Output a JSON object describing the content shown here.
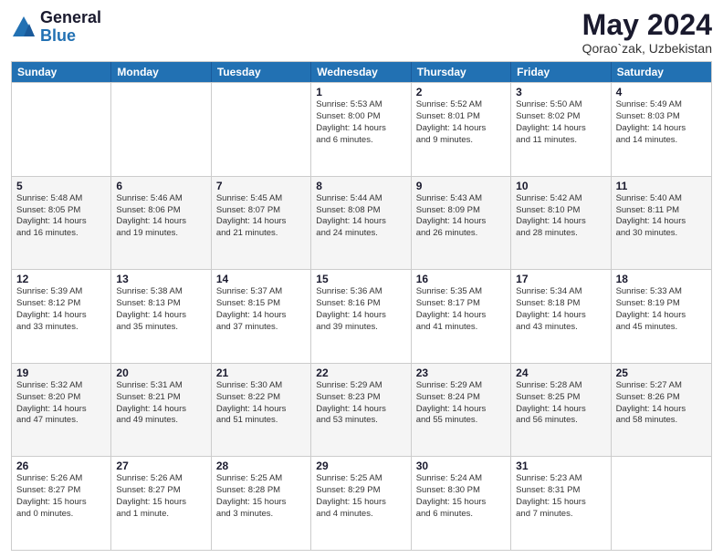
{
  "logo": {
    "general": "General",
    "blue": "Blue"
  },
  "title": "May 2024",
  "location": "Qorao`zak, Uzbekistan",
  "days_of_week": [
    "Sunday",
    "Monday",
    "Tuesday",
    "Wednesday",
    "Thursday",
    "Friday",
    "Saturday"
  ],
  "weeks": [
    [
      {
        "day": "",
        "info": ""
      },
      {
        "day": "",
        "info": ""
      },
      {
        "day": "",
        "info": ""
      },
      {
        "day": "1",
        "info": "Sunrise: 5:53 AM\nSunset: 8:00 PM\nDaylight: 14 hours\nand 6 minutes."
      },
      {
        "day": "2",
        "info": "Sunrise: 5:52 AM\nSunset: 8:01 PM\nDaylight: 14 hours\nand 9 minutes."
      },
      {
        "day": "3",
        "info": "Sunrise: 5:50 AM\nSunset: 8:02 PM\nDaylight: 14 hours\nand 11 minutes."
      },
      {
        "day": "4",
        "info": "Sunrise: 5:49 AM\nSunset: 8:03 PM\nDaylight: 14 hours\nand 14 minutes."
      }
    ],
    [
      {
        "day": "5",
        "info": "Sunrise: 5:48 AM\nSunset: 8:05 PM\nDaylight: 14 hours\nand 16 minutes."
      },
      {
        "day": "6",
        "info": "Sunrise: 5:46 AM\nSunset: 8:06 PM\nDaylight: 14 hours\nand 19 minutes."
      },
      {
        "day": "7",
        "info": "Sunrise: 5:45 AM\nSunset: 8:07 PM\nDaylight: 14 hours\nand 21 minutes."
      },
      {
        "day": "8",
        "info": "Sunrise: 5:44 AM\nSunset: 8:08 PM\nDaylight: 14 hours\nand 24 minutes."
      },
      {
        "day": "9",
        "info": "Sunrise: 5:43 AM\nSunset: 8:09 PM\nDaylight: 14 hours\nand 26 minutes."
      },
      {
        "day": "10",
        "info": "Sunrise: 5:42 AM\nSunset: 8:10 PM\nDaylight: 14 hours\nand 28 minutes."
      },
      {
        "day": "11",
        "info": "Sunrise: 5:40 AM\nSunset: 8:11 PM\nDaylight: 14 hours\nand 30 minutes."
      }
    ],
    [
      {
        "day": "12",
        "info": "Sunrise: 5:39 AM\nSunset: 8:12 PM\nDaylight: 14 hours\nand 33 minutes."
      },
      {
        "day": "13",
        "info": "Sunrise: 5:38 AM\nSunset: 8:13 PM\nDaylight: 14 hours\nand 35 minutes."
      },
      {
        "day": "14",
        "info": "Sunrise: 5:37 AM\nSunset: 8:15 PM\nDaylight: 14 hours\nand 37 minutes."
      },
      {
        "day": "15",
        "info": "Sunrise: 5:36 AM\nSunset: 8:16 PM\nDaylight: 14 hours\nand 39 minutes."
      },
      {
        "day": "16",
        "info": "Sunrise: 5:35 AM\nSunset: 8:17 PM\nDaylight: 14 hours\nand 41 minutes."
      },
      {
        "day": "17",
        "info": "Sunrise: 5:34 AM\nSunset: 8:18 PM\nDaylight: 14 hours\nand 43 minutes."
      },
      {
        "day": "18",
        "info": "Sunrise: 5:33 AM\nSunset: 8:19 PM\nDaylight: 14 hours\nand 45 minutes."
      }
    ],
    [
      {
        "day": "19",
        "info": "Sunrise: 5:32 AM\nSunset: 8:20 PM\nDaylight: 14 hours\nand 47 minutes."
      },
      {
        "day": "20",
        "info": "Sunrise: 5:31 AM\nSunset: 8:21 PM\nDaylight: 14 hours\nand 49 minutes."
      },
      {
        "day": "21",
        "info": "Sunrise: 5:30 AM\nSunset: 8:22 PM\nDaylight: 14 hours\nand 51 minutes."
      },
      {
        "day": "22",
        "info": "Sunrise: 5:29 AM\nSunset: 8:23 PM\nDaylight: 14 hours\nand 53 minutes."
      },
      {
        "day": "23",
        "info": "Sunrise: 5:29 AM\nSunset: 8:24 PM\nDaylight: 14 hours\nand 55 minutes."
      },
      {
        "day": "24",
        "info": "Sunrise: 5:28 AM\nSunset: 8:25 PM\nDaylight: 14 hours\nand 56 minutes."
      },
      {
        "day": "25",
        "info": "Sunrise: 5:27 AM\nSunset: 8:26 PM\nDaylight: 14 hours\nand 58 minutes."
      }
    ],
    [
      {
        "day": "26",
        "info": "Sunrise: 5:26 AM\nSunset: 8:27 PM\nDaylight: 15 hours\nand 0 minutes."
      },
      {
        "day": "27",
        "info": "Sunrise: 5:26 AM\nSunset: 8:27 PM\nDaylight: 15 hours\nand 1 minute."
      },
      {
        "day": "28",
        "info": "Sunrise: 5:25 AM\nSunset: 8:28 PM\nDaylight: 15 hours\nand 3 minutes."
      },
      {
        "day": "29",
        "info": "Sunrise: 5:25 AM\nSunset: 8:29 PM\nDaylight: 15 hours\nand 4 minutes."
      },
      {
        "day": "30",
        "info": "Sunrise: 5:24 AM\nSunset: 8:30 PM\nDaylight: 15 hours\nand 6 minutes."
      },
      {
        "day": "31",
        "info": "Sunrise: 5:23 AM\nSunset: 8:31 PM\nDaylight: 15 hours\nand 7 minutes."
      },
      {
        "day": "",
        "info": ""
      }
    ]
  ]
}
